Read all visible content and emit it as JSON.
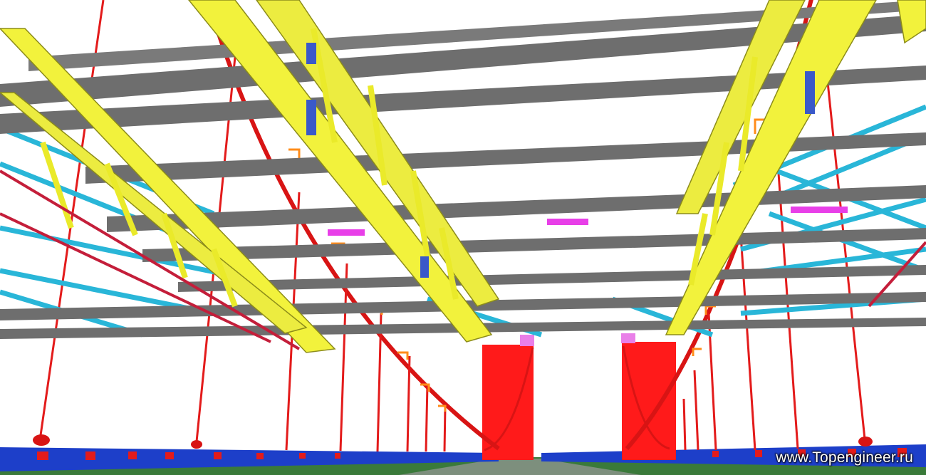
{
  "scene": {
    "subject": "3D structural model of suspension bridge with roof steel trusses",
    "colors": {
      "background": "#ffffff",
      "cables": "#e31b1b",
      "towers": "#ff1a1a",
      "trusses": "#f2f23c",
      "truss_edge": "#8c8c1a",
      "purlins": "#6e6e6e",
      "bracing": "#29b6d8",
      "deck_edge": "#1d3fc9",
      "deck": "#3a7a3a",
      "brackets": "#e83fe8",
      "clamps": "#ff8c1a"
    }
  },
  "watermark": {
    "text": "www.Topengineer.ru"
  }
}
